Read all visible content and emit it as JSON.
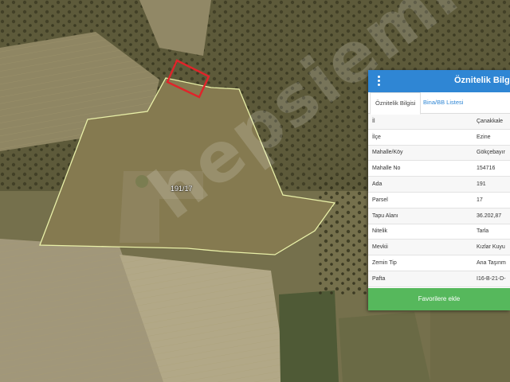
{
  "map": {
    "parcel_label": "191/17",
    "watermark": "hepsiemlak"
  },
  "panel": {
    "title": "Öznitelik Bilgisi",
    "menu_icon": "kebab-menu-icon",
    "tabs": [
      {
        "label": "Öznitelik Bilgisi",
        "active": true
      },
      {
        "label": "Bina/BB Listesi",
        "active": false
      }
    ],
    "rows": [
      {
        "key": "İl",
        "value": "Çanakkale"
      },
      {
        "key": "İlçe",
        "value": "Ezine"
      },
      {
        "key": "Mahalle/Köy",
        "value": "Gökçebayır"
      },
      {
        "key": "Mahalle No",
        "value": "154716"
      },
      {
        "key": "Ada",
        "value": "191"
      },
      {
        "key": "Parsel",
        "value": "17"
      },
      {
        "key": "Tapu Alanı",
        "value": "36.202,87"
      },
      {
        "key": "Nitelik",
        "value": "Tarla"
      },
      {
        "key": "Mevkii",
        "value": "Kızlar Kuyu"
      },
      {
        "key": "Zemin Tip",
        "value": "Ana Taşınm"
      },
      {
        "key": "Pafta",
        "value": "I16-B-21-D-"
      }
    ],
    "favorite_button": "Favorilere ekle",
    "colors": {
      "header": "#2f86d4",
      "button": "#56b85c",
      "parcel_outline": "#e9f0a8",
      "highlight": "#e0242a"
    }
  }
}
